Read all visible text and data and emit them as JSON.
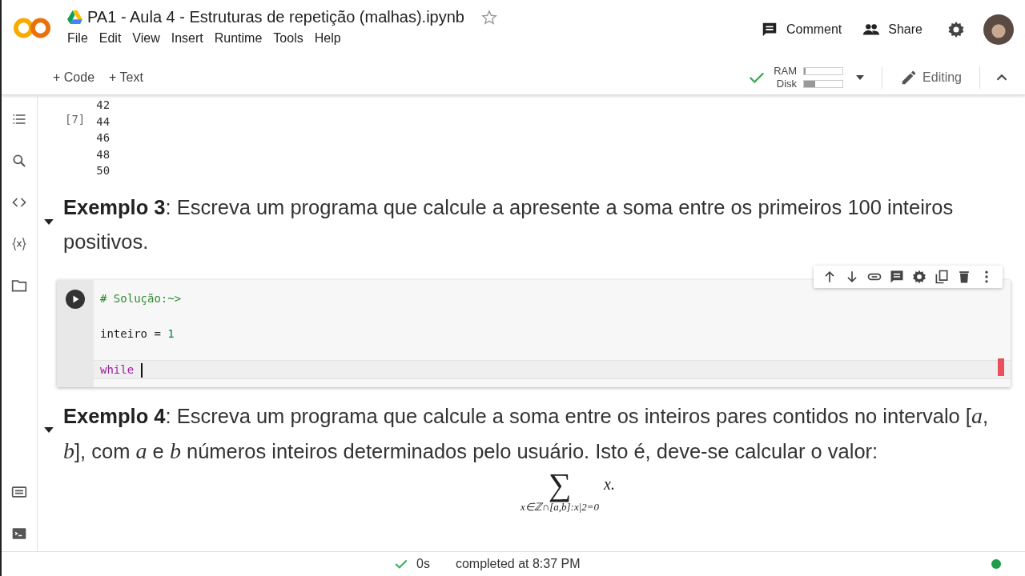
{
  "header": {
    "title": "PA1 - Aula 4 - Estruturas de repetição (malhas).ipynb",
    "menu": [
      "File",
      "Edit",
      "View",
      "Insert",
      "Runtime",
      "Tools",
      "Help"
    ],
    "actions": [
      "Comment",
      "Share"
    ]
  },
  "toolbar": {
    "add": [
      "+ Code",
      "+ Text"
    ],
    "ram_label": "RAM",
    "disk_label": "Disk",
    "ram": {
      "level": 0.05
    },
    "disk": {
      "level": 0.3
    },
    "mode": "Editing"
  },
  "output": {
    "exec_count": "[7]",
    "lines": [
      "42",
      "44",
      "46",
      "48",
      "50"
    ]
  },
  "example3": {
    "text": "**Exemplo 3**: Escreva um programa que calcule a apresente a soma entre os primeiros 100 inteiros positivos."
  },
  "code_cell": {
    "lines": [
      {
        "current": false,
        "tokens": [
          {
            "kind": "comment",
            "text": "# Solução:~>"
          }
        ]
      },
      {
        "current": false,
        "tokens": [
          {
            "kind": "name",
            "text": "inteiro = "
          },
          {
            "kind": "number",
            "text": "1"
          }
        ]
      },
      {
        "current": true,
        "tokens": [
          {
            "kind": "keyword",
            "text": "while"
          }
        ]
      }
    ]
  },
  "example4": {
    "text": "**Exemplo 4**: Escreva um programa que calcule a soma entre os inteiros pares contidos no intervalo [*a*, *b*], com *a* e *b* números inteiros determinados pelo usuário. Isto é, deve-se calcular o valor:",
    "sum_symbol": "∑",
    "sum_sub": "x∈ℤ∩[a,b]:x|2=0",
    "sum_body": "x."
  },
  "status_bar": {
    "duration": "0s",
    "message": "completed at 8:37 PM"
  }
}
